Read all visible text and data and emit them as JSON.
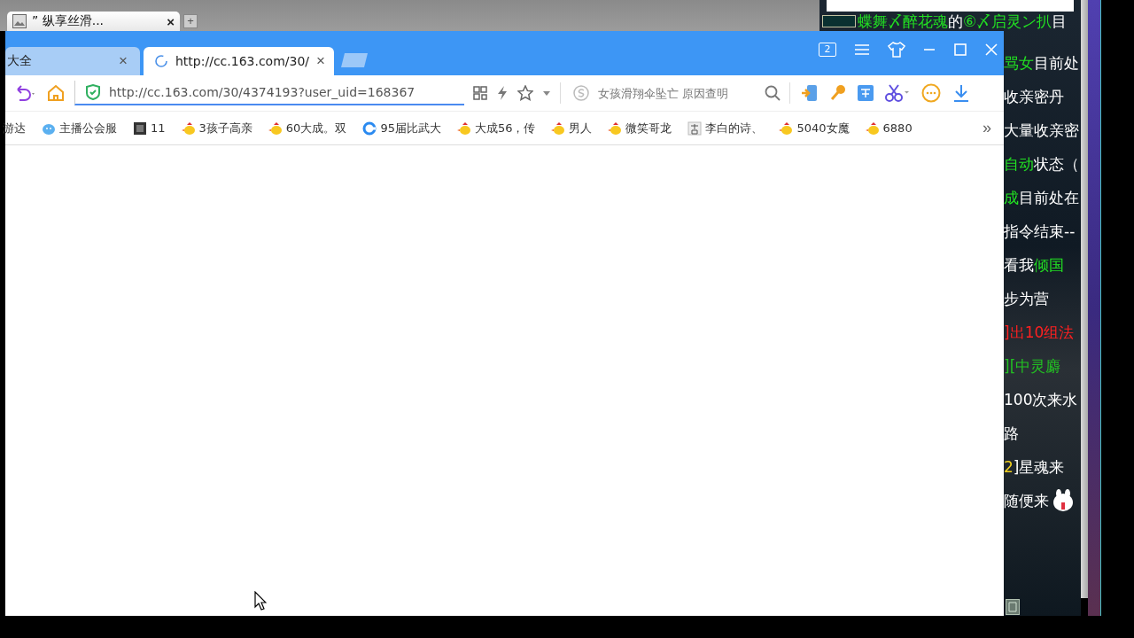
{
  "background_window": {
    "tab": {
      "title": "” 纵享丝滑...",
      "close": "×"
    },
    "new_tab": "+"
  },
  "browser": {
    "tabs": [
      {
        "title": "大全",
        "selected": false,
        "loading": false,
        "close": "×"
      },
      {
        "title": "http://cc.163.com/30/",
        "selected": true,
        "loading": true,
        "close": "×"
      }
    ],
    "window_count": "2",
    "address": {
      "url": "http://cc.163.com/30/4374193?user_uid=168367"
    },
    "search": {
      "placeholder": "女孩滑翔伞坠亡 原因查明"
    },
    "bookmarks": [
      {
        "label": "游达",
        "kind": "none"
      },
      {
        "label": "主播公会服",
        "kind": "cloud"
      },
      {
        "label": "11",
        "kind": "dark"
      },
      {
        "label": "3孩子高亲",
        "kind": "chick"
      },
      {
        "label": "60大成。双",
        "kind": "chick"
      },
      {
        "label": "95届比武大",
        "kind": "ring"
      },
      {
        "label": "大成56，传",
        "kind": "chick"
      },
      {
        "label": "男人",
        "kind": "chick"
      },
      {
        "label": "微笑哥龙",
        "kind": "chick"
      },
      {
        "label": "李白的诗、",
        "kind": "page"
      },
      {
        "label": "5040女魔",
        "kind": "chick"
      },
      {
        "label": "6880",
        "kind": "chick"
      }
    ],
    "more": "»"
  },
  "chat": {
    "header": {
      "segments": [
        {
          "text": "蝶舞〆醉花魂",
          "color": "#22e022"
        },
        {
          "text": "的",
          "color": "#ffffff"
        },
        {
          "text": "⑥〆启灵ン扒",
          "color": "#22e022"
        },
        {
          "text": "目",
          "color": "#ffffff"
        }
      ]
    },
    "lines": [
      {
        "segments": [
          {
            "text": "骂女",
            "color": "#22e022"
          },
          {
            "text": "目前处",
            "color": "#ffffff"
          }
        ]
      },
      {
        "segments": [
          {
            "text": "收亲密丹",
            "color": "#ffffff"
          }
        ]
      },
      {
        "segments": [
          {
            "text": "大量收亲密",
            "color": "#ffffff"
          }
        ]
      },
      {
        "segments": [
          {
            "text": "自动",
            "color": "#22e022"
          },
          {
            "text": "状态（",
            "color": "#ffffff"
          }
        ]
      },
      {
        "segments": [
          {
            "text": "成",
            "color": "#22e022"
          },
          {
            "text": "目前处在",
            "color": "#ffffff"
          }
        ]
      },
      {
        "segments": [
          {
            "text": "指令结束--",
            "color": "#ffffff"
          }
        ]
      },
      {
        "segments": [
          {
            "text": "看我",
            "color": "#ffffff"
          },
          {
            "text": "倾国",
            "color": "#22e022"
          }
        ]
      },
      {
        "segments": [
          {
            "text": "步为营",
            "color": "#ffffff"
          }
        ]
      },
      {
        "segments": [
          {
            "text": "]出10组法",
            "color": "#ff2020"
          }
        ]
      },
      {
        "segments": [
          {
            "text": "][中灵麝",
            "color": "#22c022"
          }
        ]
      },
      {
        "segments": [
          {
            "text": "100次来水",
            "color": "#ffffff"
          }
        ]
      },
      {
        "segments": [
          {
            "text": "路",
            "color": "#ffffff"
          }
        ]
      },
      {
        "segments": [
          {
            "text": "2",
            "color": "#f0d020"
          },
          {
            "text": "]星魂来",
            "color": "#ffffff"
          }
        ]
      },
      {
        "segments": [
          {
            "text": "随便来",
            "color": "#ffffff"
          }
        ]
      }
    ]
  }
}
